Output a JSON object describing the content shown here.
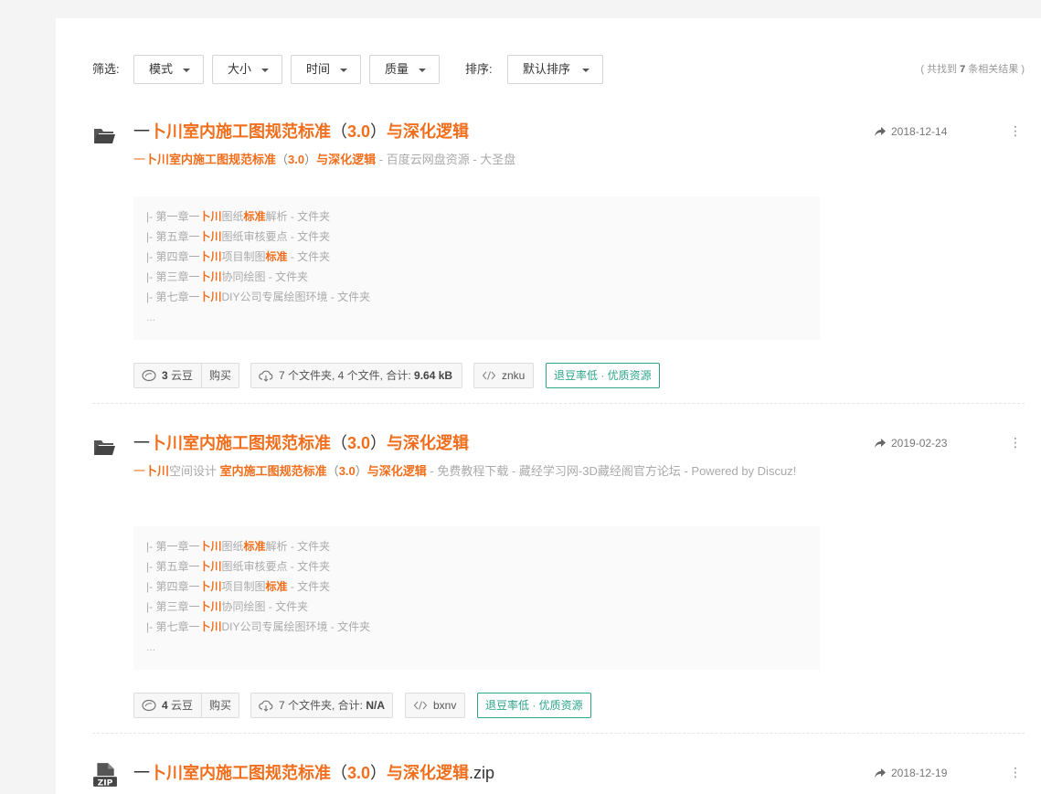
{
  "filters": {
    "label": "筛选:",
    "dropdowns": [
      "模式",
      "大小",
      "时间",
      "质量"
    ],
    "sort_label": "排序:",
    "sort_value": "默认排序",
    "result_count_prefix": "( 共找到 ",
    "result_count": "7",
    "result_count_suffix": " 条相关结果 )"
  },
  "results": [
    {
      "type": "folder",
      "title_prefix": "一",
      "title_hl1": "卜川室内施工图规范标准",
      "title_paren_open": "（",
      "title_hl2": "3.0",
      "title_paren_close": "）",
      "title_hl3": "与深化逻辑",
      "title_suffix": "",
      "date": "2018-12-14",
      "subtitle": {
        "p1": "一",
        "h1": "卜川室内施工图规范标准",
        "p2": "（",
        "h2": "3.0",
        "p3": "）",
        "h3": "与深化逻辑",
        "p4": " - 百度云网盘资源 - 大圣盘"
      },
      "files": [
        {
          "a": "|- 第一章一",
          "h": "卜川",
          "b": "图纸",
          "h2": "标准",
          "c": "解析 - 文件夹"
        },
        {
          "a": "|- 第五章一",
          "h": "卜川",
          "b": "图纸审核要点 - 文件夹",
          "h2": "",
          "c": ""
        },
        {
          "a": "|- 第四章一",
          "h": "卜川",
          "b": "项目制图",
          "h2": "标准",
          "c": " - 文件夹"
        },
        {
          "a": "|- 第三章一",
          "h": "卜川",
          "b": "协同绘图 - 文件夹",
          "h2": "",
          "c": ""
        },
        {
          "a": "|- 第七章一",
          "h": "卜川",
          "b": "DIY公司专属绘图环境 - 文件夹",
          "h2": "",
          "c": ""
        }
      ],
      "dots": "...",
      "coins": "3",
      "coins_unit": " 云豆",
      "buy": "购买",
      "size_text": "7 个文件夹, 4 个文件, 合计: ",
      "size_value": "9.64 kB",
      "code": "znku",
      "badge": "退豆率低 · 优质资源"
    },
    {
      "type": "folder",
      "title_prefix": "一",
      "title_hl1": "卜川室内施工图规范标准",
      "title_paren_open": "（",
      "title_hl2": "3.0",
      "title_paren_close": "）",
      "title_hl3": "与深化逻辑",
      "title_suffix": "",
      "date": "2019-02-23",
      "subtitle": {
        "p1": "一",
        "h1": "卜川",
        "p2": "空间设计 ",
        "h2": "室内施工图规范标准",
        "p3": "（",
        "h3": "3.0",
        "p4": "）",
        "h4": "与深化逻辑",
        "p5": " - 免费教程下载 - 藏经学习网-3D藏经阁官方论坛 - Powered by Discuz!"
      },
      "files": [
        {
          "a": "|- 第一章一",
          "h": "卜川",
          "b": "图纸",
          "h2": "标准",
          "c": "解析 - 文件夹"
        },
        {
          "a": "|- 第五章一",
          "h": "卜川",
          "b": "图纸审核要点 - 文件夹",
          "h2": "",
          "c": ""
        },
        {
          "a": "|- 第四章一",
          "h": "卜川",
          "b": "项目制图",
          "h2": "标准",
          "c": " - 文件夹"
        },
        {
          "a": "|- 第三章一",
          "h": "卜川",
          "b": "协同绘图 - 文件夹",
          "h2": "",
          "c": ""
        },
        {
          "a": "|- 第七章一",
          "h": "卜川",
          "b": "DIY公司专属绘图环境 - 文件夹",
          "h2": "",
          "c": ""
        }
      ],
      "dots": "...",
      "coins": "4",
      "coins_unit": " 云豆",
      "buy": "购买",
      "size_text": "7 个文件夹, 合计: ",
      "size_value": "N/A",
      "code": "bxnv",
      "badge": "退豆率低 · 优质资源"
    },
    {
      "type": "zip",
      "icon_label": "ZIP",
      "title_prefix": "一",
      "title_hl1": "卜川室内施工图规范标准",
      "title_paren_open": "（",
      "title_hl2": "3.0",
      "title_paren_close": "）",
      "title_hl3": "与深化逻辑",
      "title_suffix": ".zip",
      "date": "2018-12-19"
    }
  ],
  "more_glyph": "⋮",
  "colors": {
    "highlight": "#f06e1c",
    "badge": "#2da58c"
  }
}
